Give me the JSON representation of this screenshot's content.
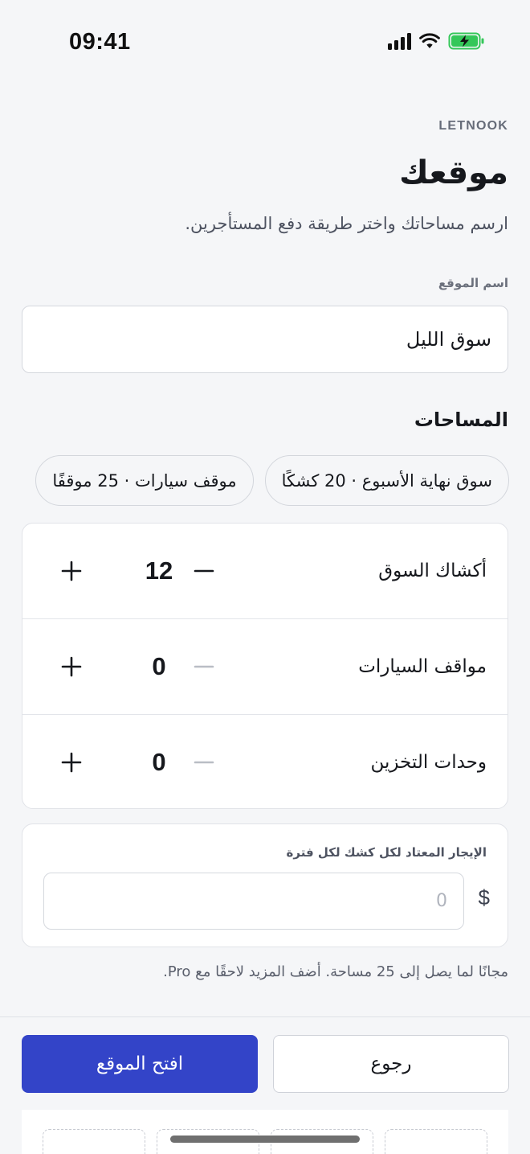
{
  "status_bar": {
    "time": "09:41"
  },
  "brand": "LETNOOK",
  "title": "موقعك",
  "subtitle": "ارسم مساحاتك واختر طريقة دفع المستأجرين.",
  "site_name": {
    "label": "اسم الموقع",
    "value": "سوق الليل"
  },
  "spaces": {
    "title": "المساحات",
    "presets": [
      "سوق نهاية الأسبوع · 20 كشكًا",
      "موقف سيارات · 25 موقفًا"
    ],
    "counters": [
      {
        "label": "أكشاك السوق",
        "value": "12"
      },
      {
        "label": "مواقف السيارات",
        "value": "0"
      },
      {
        "label": "وحدات التخزين",
        "value": "0"
      }
    ]
  },
  "rent": {
    "label": "الإيجار المعتاد لكل كشك لكل فترة",
    "currency": "$",
    "placeholder": "0"
  },
  "footnote": "مجانًا لما يصل إلى 25 مساحة. أضف المزيد لاحقًا مع Pro.",
  "actions": {
    "back": "رجوع",
    "open_site": "افتح الموقع"
  },
  "colors": {
    "primary": "#3344c8",
    "battery": "#34c759"
  }
}
